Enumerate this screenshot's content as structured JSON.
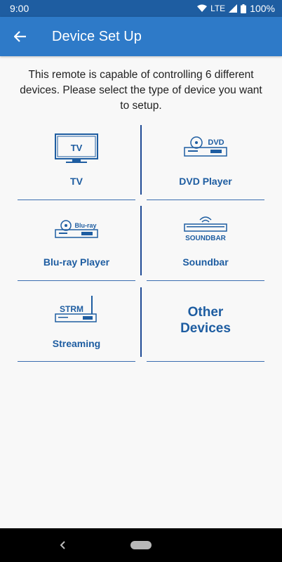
{
  "status_bar": {
    "time": "9:00",
    "network": "LTE",
    "battery": "100%"
  },
  "app_bar": {
    "title": "Device Set Up"
  },
  "intro_text": "This remote is capable of controlling 6 different devices. Please select the type of device you want to setup.",
  "devices": [
    {
      "label": "TV",
      "icon": "tv-icon",
      "icon_text": "TV"
    },
    {
      "label": "DVD Player",
      "icon": "dvd-player-icon",
      "icon_text": "DVD"
    },
    {
      "label": "Blu-ray Player",
      "icon": "bluray-player-icon",
      "icon_text": "Blu-ray"
    },
    {
      "label": "Soundbar",
      "icon": "soundbar-icon",
      "icon_text": "SOUNDBAR"
    },
    {
      "label": "Streaming",
      "icon": "streaming-icon",
      "icon_text": "STRM"
    },
    {
      "label": "Other Devices"
    }
  ],
  "colors": {
    "accent": "#1e5da1",
    "app_bar": "#2e7ac8",
    "status_bar": "#1e5da1"
  }
}
